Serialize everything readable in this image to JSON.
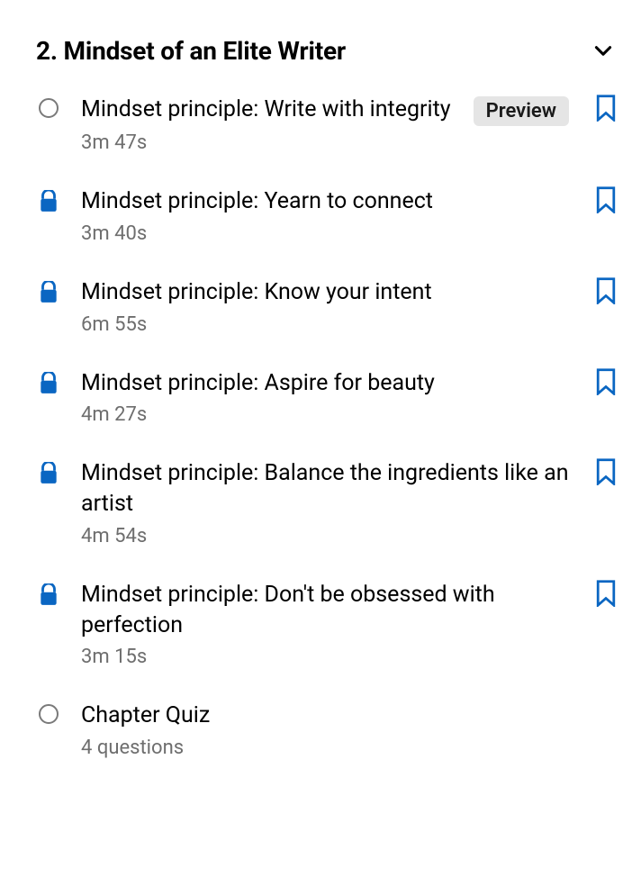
{
  "section": {
    "title": "2. Mindset of an Elite Writer"
  },
  "colors": {
    "accent": "#0a66c2",
    "muted": "#6e6e6e",
    "badge_bg": "#e5e5e5"
  },
  "lessons": [
    {
      "status": "circle",
      "title": "Mindset principle: Write with integrity",
      "duration": "3m 47s",
      "preview": "Preview",
      "bookmark": true
    },
    {
      "status": "locked",
      "title": "Mindset principle: Yearn to connect",
      "duration": "3m 40s",
      "preview": null,
      "bookmark": true
    },
    {
      "status": "locked",
      "title": "Mindset principle: Know your intent",
      "duration": "6m 55s",
      "preview": null,
      "bookmark": true
    },
    {
      "status": "locked",
      "title": "Mindset principle: Aspire for beauty",
      "duration": "4m 27s",
      "preview": null,
      "bookmark": true
    },
    {
      "status": "locked",
      "title": "Mindset principle: Balance the ingredients like an artist",
      "duration": "4m 54s",
      "preview": null,
      "bookmark": true
    },
    {
      "status": "locked",
      "title": "Mindset principle: Don't be obsessed with perfection",
      "duration": "3m 15s",
      "preview": null,
      "bookmark": true
    },
    {
      "status": "circle",
      "title": "Chapter Quiz",
      "duration": "4 questions",
      "preview": null,
      "bookmark": false
    }
  ]
}
